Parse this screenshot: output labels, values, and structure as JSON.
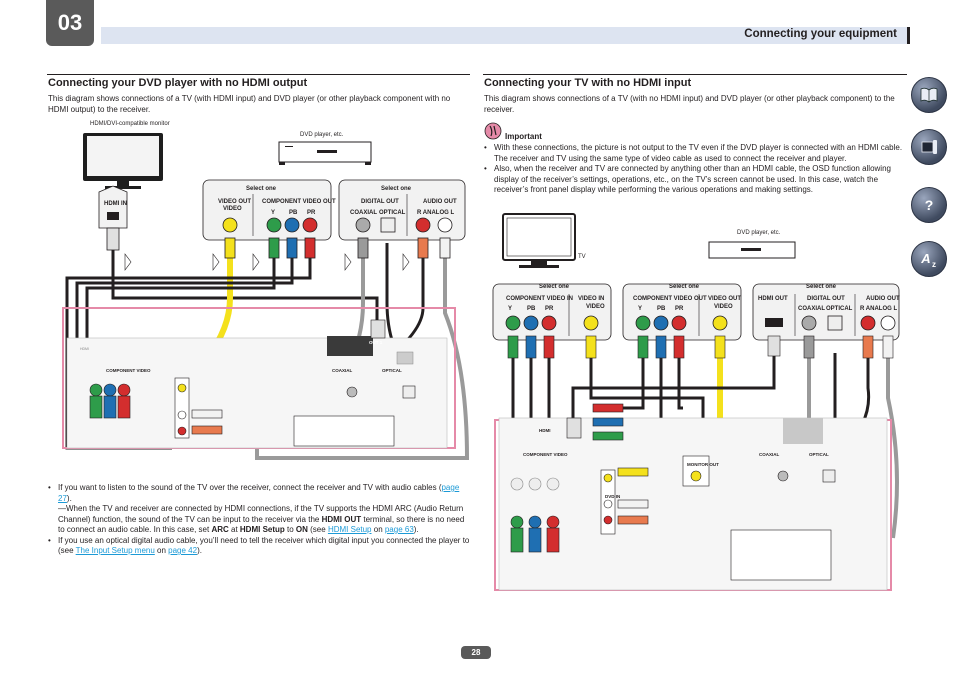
{
  "header": {
    "chapter": "03",
    "title": "Connecting your equipment"
  },
  "left": {
    "title": "Connecting your DVD player with no HDMI output",
    "intro": "This diagram shows connections of a TV (with HDMI input) and DVD player (or other playback component with no HDMI output) to the receiver.",
    "tv_caption": "HDMI/DVI-compatible monitor",
    "dvd_caption": "DVD player, etc.",
    "hdmi_in_label": "HDMI IN",
    "select_one_1": "Select one",
    "select_one_2": "Select one",
    "video_out_label": "VIDEO OUT",
    "video_label": "VIDEO",
    "component_out_label": "COMPONENT VIDEO OUT",
    "y": "Y",
    "pb": "PB",
    "pr": "PR",
    "digital_out_label": "DIGITAL OUT",
    "coaxial": "COAXIAL",
    "optical": "OPTICAL",
    "audio_out_label": "AUDIO OUT",
    "r_analog_l": "R  ANALOG  L",
    "bullet1_a": "If you want to listen to the sound of the TV over the receiver, connect the receiver and TV with audio cables (",
    "bullet1_link": "page 27",
    "bullet1_b": ").",
    "note_a": "When the TV and receiver are connected by HDMI connections, if the TV supports the HDMI ARC (Audio Return Channel) function, the sound of the TV can be input to the receiver via the ",
    "note_bold1": "HDMI OUT",
    "note_b": " terminal, so there is no need to connect an audio cable. In this case, set ",
    "note_bold2": "ARC",
    "note_c": " at ",
    "note_bold3": "HDMI Setup",
    "note_d": " to ",
    "note_bold4": "ON",
    "note_e": " (see ",
    "note_link1": "HDMI Setup",
    "note_f": " on ",
    "note_link2": "page 63",
    "note_g": ").",
    "bullet2_a": "If you use an optical digital audio cable, you’ll need to tell the receiver which digital input you connected the player to (see ",
    "bullet2_link1": "The Input Setup menu",
    "bullet2_b": " on ",
    "bullet2_link2": "page 42",
    "bullet2_c": ")."
  },
  "right": {
    "title": "Connecting your TV with no HDMI input",
    "intro": "This diagram shows connections of a TV (with no HDMI input) and DVD player (or other playback component) to the receiver.",
    "important_label": "Important",
    "bullet1": "With these connections, the picture is not output to the TV even if the DVD player is connected with an HDMI cable. The receiver and TV using the same type of video cable as used to connect the receiver and player.",
    "bullet2": "Also, when the receiver and TV are connected by anything other than an HDMI cable, the OSD function allowing display of the receiver’s settings, operations, etc., on the TV’s screen cannot be used. In this case, watch the receiver’s front panel display while performing the various operations and making settings.",
    "tv_caption": "TV",
    "dvd_caption": "DVD player, etc.",
    "select_one_1": "Select one",
    "select_one_2": "Select one",
    "select_one_3": "Select one",
    "component_in_label": "COMPONENT VIDEO IN",
    "video_in_label": "VIDEO IN",
    "component_out_label": "COMPONENT VIDEO OUT",
    "video_out_label": "VIDEO OUT",
    "video_label": "VIDEO",
    "hdmi_out_label": "HDMI OUT",
    "digital_out_label": "DIGITAL OUT",
    "coaxial": "COAXIAL",
    "optical": "OPTICAL",
    "audio_out_label": "AUDIO OUT",
    "r_analog_l": "R  ANALOG  L",
    "y": "Y",
    "pb": "PB",
    "pr": "PR"
  },
  "receiver": {
    "hdmi": "HDMI",
    "component_video": "COMPONENT VIDEO",
    "coaxial": "COAXIAL",
    "optical": "OPTICAL",
    "assignable": "ASSIGNABLE",
    "in1_dvd": "IN 1 (DVD)",
    "in2_dvr": "IN 2 (DVR/BDR)",
    "out1": "OUT 1",
    "monitor_out": "MONITOR OUT",
    "dvd_in": "DVD IN"
  },
  "page_number": "28",
  "colors": {
    "yellow": "#f4e11c",
    "green": "#2e9c4a",
    "blue": "#1f6fb2",
    "red": "#d32e2e",
    "orange": "#e87a4e",
    "white": "#f2f2f2",
    "pink_border": "#e58aa8",
    "gray_cable": "#9a9a9a",
    "header_bg": "#dde4f1"
  },
  "nav_icons": [
    "book-icon",
    "remote-icon",
    "help-icon",
    "glossary-icon"
  ]
}
